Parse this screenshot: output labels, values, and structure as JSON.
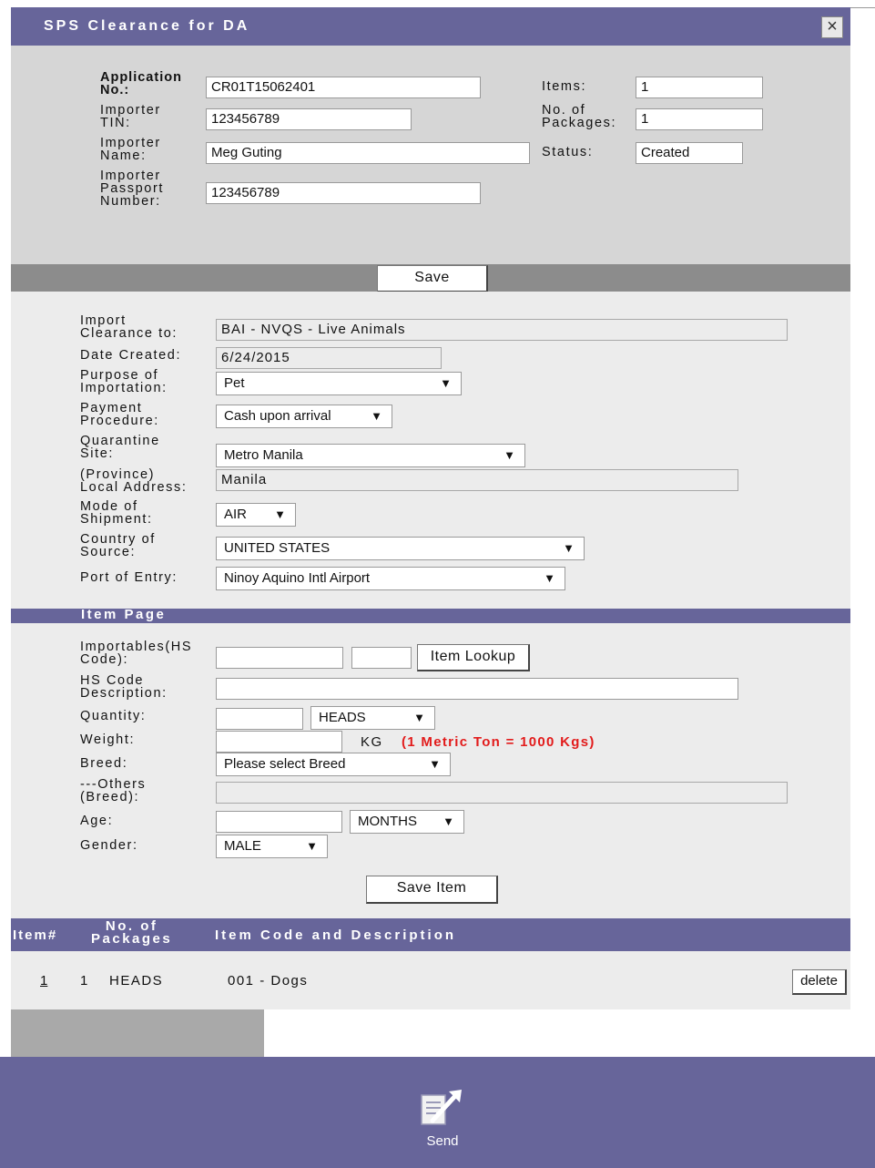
{
  "dialog": {
    "title": "SPS Clearance for DA",
    "close_glyph": "×"
  },
  "header_form": {
    "application_no_label": [
      "Application",
      "No.:"
    ],
    "application_no_value": "CR01T15062401",
    "importer_tin_label": [
      "Importer",
      "TIN:"
    ],
    "importer_tin_value": "123456789",
    "importer_name_label": [
      "Importer",
      "Name:"
    ],
    "importer_name_value": "Meg Guting",
    "importer_passport_label": [
      "Importer",
      "Passport",
      "Number:"
    ],
    "importer_passport_value": "123456789",
    "items_label": "Items:",
    "items_value": "1",
    "packages_label": [
      "No. of",
      "Packages:"
    ],
    "packages_value": "1",
    "status_label": "Status:",
    "status_value": "Created",
    "save_label": "Save"
  },
  "clearance_form": {
    "import_clearance_label": [
      "Import",
      "Clearance to:"
    ],
    "import_clearance_value": "BAI - NVQS - Live Animals",
    "date_created_label": "Date Created:",
    "date_created_value": "6/24/2015",
    "purpose_label": [
      "Purpose of",
      "Importation:"
    ],
    "purpose_value": "Pet",
    "payment_label": [
      "Payment",
      "Procedure:"
    ],
    "payment_value": "Cash upon arrival",
    "quarantine_label": [
      "Quarantine",
      "Site:"
    ],
    "quarantine_value": "Metro Manila",
    "province_label": [
      "(Province)",
      "Local Address:"
    ],
    "province_value": "Manila",
    "mode_label": [
      "Mode of",
      "Shipment:"
    ],
    "mode_value": "AIR",
    "country_label": [
      "Country of",
      "Source:"
    ],
    "country_value": "UNITED STATES",
    "port_label": "Port of Entry:",
    "port_value": "Ninoy Aquino Intl Airport"
  },
  "item_page": {
    "title": "Item Page",
    "hs_code_label": [
      "Importables(HS",
      "Code):"
    ],
    "hs_code_value": "",
    "hs_code_value2": "",
    "item_lookup_label": "Item Lookup",
    "hs_desc_label": [
      "HS Code",
      "Description:"
    ],
    "hs_desc_value": "",
    "quantity_label": "Quantity:",
    "quantity_value": "",
    "quantity_unit": "HEADS",
    "weight_label": "Weight:",
    "weight_value": "",
    "weight_unit": "KG",
    "weight_note": "(1 Metric Ton = 1000 Kgs)",
    "breed_label": "Breed:",
    "breed_value": "Please select Breed",
    "others_label": [
      "---Others",
      "(Breed):"
    ],
    "others_value": "",
    "age_label": "Age:",
    "age_value": "",
    "age_unit": "MONTHS",
    "gender_label": "Gender:",
    "gender_value": "MALE",
    "save_item_label": "Save Item"
  },
  "items_table": {
    "headers": {
      "item_no": "Item#",
      "packages": [
        "No. of",
        "Packages"
      ],
      "code_desc": "Item Code and Description"
    },
    "rows": [
      {
        "item_no": "1",
        "packages": "1",
        "unit": "HEADS",
        "description": "001 - Dogs",
        "delete_label": "delete"
      }
    ]
  },
  "footer": {
    "send_label": "Send"
  },
  "colors": {
    "band": "#67659a",
    "panel": "#d6d6d6",
    "divider": "#8c8c8c",
    "note_red": "#e21b1b"
  }
}
